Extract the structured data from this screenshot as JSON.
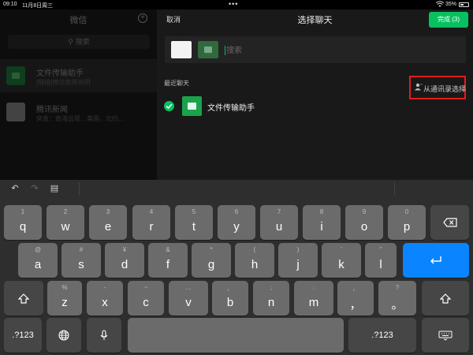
{
  "status_bar": {
    "time": "09:10",
    "date": "11月8日周三",
    "dots": "•••",
    "battery_percent": "35%"
  },
  "left_panel": {
    "title": "微信",
    "search_placeholder": "搜索",
    "chats": [
      {
        "name": "文件传输助手",
        "preview": "[链接]微信使用说明"
      },
      {
        "name": "腾讯新闻",
        "preview": "突发：南海出现…美国，北约…"
      }
    ]
  },
  "right_panel": {
    "cancel_label": "取消",
    "title": "选择聊天",
    "done_label": "完成 (3)",
    "search_placeholder": "搜索",
    "section_label": "最近聊天",
    "from_contacts_label": "从通讯录选择",
    "recent_items": [
      {
        "name": "文件传输助手",
        "checked": true
      }
    ]
  },
  "keyboard": {
    "toolbar": [
      "undo-icon",
      "redo-icon",
      "paste-icon"
    ],
    "row1": [
      {
        "top": "1",
        "main": "q"
      },
      {
        "top": "2",
        "main": "w"
      },
      {
        "top": "3",
        "main": "e"
      },
      {
        "top": "4",
        "main": "r"
      },
      {
        "top": "5",
        "main": "t"
      },
      {
        "top": "6",
        "main": "y"
      },
      {
        "top": "7",
        "main": "u"
      },
      {
        "top": "8",
        "main": "i"
      },
      {
        "top": "9",
        "main": "o"
      },
      {
        "top": "0",
        "main": "p"
      }
    ],
    "row2": [
      {
        "top": "@",
        "main": "a"
      },
      {
        "top": "#",
        "main": "s"
      },
      {
        "top": "¥",
        "main": "d"
      },
      {
        "top": "&",
        "main": "f"
      },
      {
        "top": "*",
        "main": "g"
      },
      {
        "top": "(",
        "main": "h"
      },
      {
        "top": ")",
        "main": "j"
      },
      {
        "top": "'",
        "main": "k"
      },
      {
        "top": "\"",
        "main": "l"
      }
    ],
    "row3": [
      {
        "top": "%",
        "main": "z"
      },
      {
        "top": "-",
        "main": "x"
      },
      {
        "top": "~",
        "main": "c"
      },
      {
        "top": "…",
        "main": "v"
      },
      {
        "top": "、",
        "main": "b"
      },
      {
        "top": ";",
        "main": "n"
      },
      {
        "top": ":",
        "main": "m"
      },
      {
        "top": "，",
        "main": "，"
      },
      {
        "top": "?",
        "main": "。"
      }
    ],
    "numbers_label": ".?123",
    "accent_color": "#0a84ff"
  },
  "colors": {
    "wechat_green": "#07c160",
    "highlight_red": "#e31b1b"
  }
}
